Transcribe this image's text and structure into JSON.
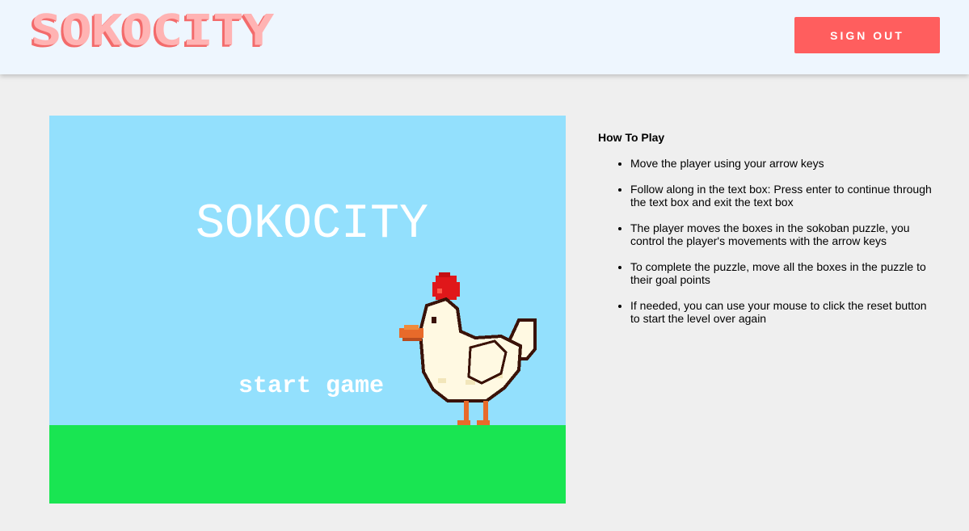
{
  "header": {
    "logo_text": "SOKOCITY",
    "sign_out_label": "SIGN OUT"
  },
  "game": {
    "title": "SOKOCITY",
    "start_label": "start game",
    "colors": {
      "sky": "#93e0fd",
      "ground": "#19e552"
    }
  },
  "instructions": {
    "heading": "How To Play",
    "items": [
      "Move the player using your arrow keys",
      "Follow along in the text box: Press enter to continue through the text box and exit the text box",
      "The player moves the boxes in the sokoban puzzle, you control the player's movements with the arrow keys",
      "To complete the puzzle, move all the boxes in the puzzle to their goal points",
      "If needed, you can use your mouse to click the reset button to start the level over again"
    ]
  },
  "colors": {
    "accent": "#ff5e5e",
    "logo": "#ffb3b3"
  }
}
